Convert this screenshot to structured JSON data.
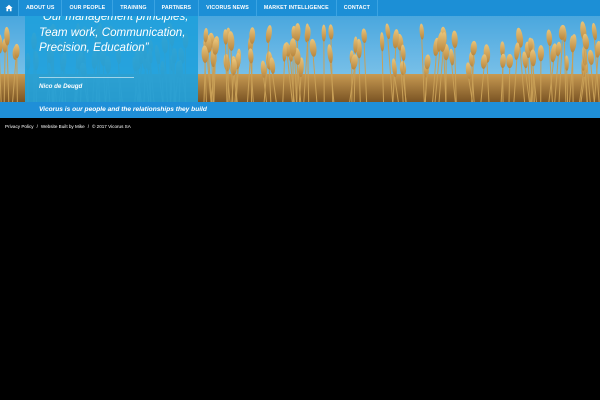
{
  "nav": {
    "home_icon": "home-icon",
    "items": [
      {
        "label": "ABOUT US"
      },
      {
        "label": "OUR PEOPLE"
      },
      {
        "label": "TRAINING"
      },
      {
        "label": "PARTNERS"
      },
      {
        "label": "VICORUS NEWS"
      },
      {
        "label": "MARKET INTELLIGENCE"
      },
      {
        "label": "CONTACT"
      }
    ]
  },
  "hero": {
    "quote": "“Our management principles; Team work, Communication, Precision, Education”",
    "author": "Nico de Deugd"
  },
  "tagline": "Vicorus is our people and the relationships they build",
  "footer": {
    "privacy": "Privacy Policy",
    "separator": "/",
    "built_by": "Website Built by Mike",
    "copyright": "© 2017 Vicorus SA"
  },
  "colors": {
    "nav_bg": "#1c8fd6",
    "accent_blue": "#20a0dc",
    "band_blue": "#1f8fd8",
    "page_bg": "#000000"
  }
}
